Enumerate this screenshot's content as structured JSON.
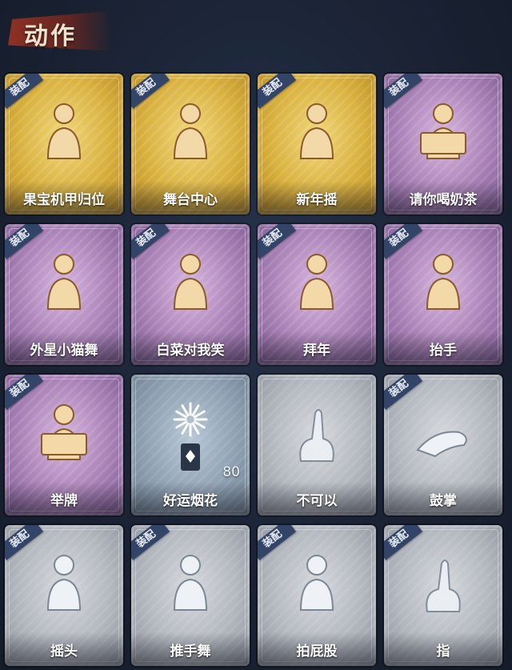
{
  "header": {
    "title": "动作"
  },
  "equip_badge": "装配",
  "colors": {
    "gold": "#d9b13e",
    "purple": "#a981b6",
    "blue": "#8fa1b2",
    "gray": "#b3b8bf",
    "badge": "#324468"
  },
  "cards": [
    {
      "label": "果宝机甲归位",
      "rarity": "gold",
      "equipped": true,
      "icon": "figure-hands-chest-icon"
    },
    {
      "label": "舞台中心",
      "rarity": "gold",
      "equipped": true,
      "icon": "figure-pose-icon"
    },
    {
      "label": "新年摇",
      "rarity": "gold",
      "equipped": true,
      "icon": "figure-clap-icon"
    },
    {
      "label": "请你喝奶茶",
      "rarity": "purple",
      "equipped": true,
      "icon": "figure-sign-icon"
    },
    {
      "label": "外星小猫舞",
      "rarity": "purple",
      "equipped": true,
      "icon": "figure-cat-dance-icon"
    },
    {
      "label": "白菜对我笑",
      "rarity": "purple",
      "equipped": true,
      "icon": "figure-cat-dance-icon"
    },
    {
      "label": "拜年",
      "rarity": "purple",
      "equipped": true,
      "icon": "figure-bow-icon"
    },
    {
      "label": "抬手",
      "rarity": "purple",
      "equipped": true,
      "icon": "figure-raise-hand-icon"
    },
    {
      "label": "举牌",
      "rarity": "purple",
      "equipped": true,
      "icon": "figure-hold-sign-icon"
    },
    {
      "label": "好运烟花",
      "rarity": "blue",
      "equipped": false,
      "icon": "firework-icon",
      "count": "80"
    },
    {
      "label": "不可以",
      "rarity": "gray",
      "equipped": false,
      "icon": "finger-wag-icon"
    },
    {
      "label": "鼓掌",
      "rarity": "gray",
      "equipped": true,
      "icon": "clap-hands-icon"
    },
    {
      "label": "摇头",
      "rarity": "gray",
      "equipped": true,
      "icon": "figure-shake-head-icon"
    },
    {
      "label": "推手舞",
      "rarity": "gray",
      "equipped": true,
      "icon": "figure-push-dance-icon"
    },
    {
      "label": "拍屁股",
      "rarity": "gray",
      "equipped": true,
      "icon": "figure-bend-icon"
    },
    {
      "label": "指",
      "rarity": "gray",
      "equipped": true,
      "icon": "pointing-hand-icon"
    }
  ]
}
